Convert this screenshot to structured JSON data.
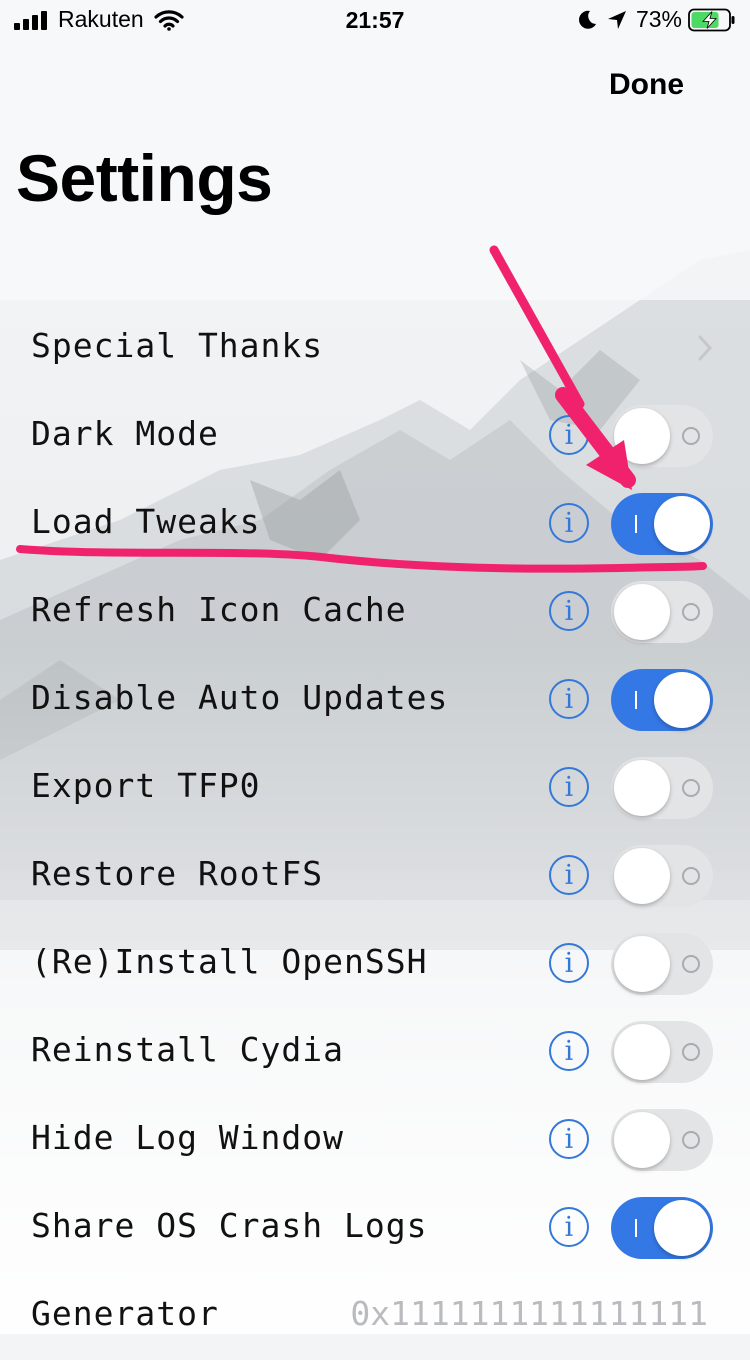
{
  "status_bar": {
    "carrier": "Rakuten",
    "time": "21:57",
    "battery_percent": "73%",
    "battery_level": 0.73,
    "icons": [
      "signal-icon",
      "wifi-icon",
      "moon-icon",
      "location-icon",
      "battery-charging-icon"
    ]
  },
  "nav": {
    "done_label": "Done"
  },
  "page": {
    "title": "Settings"
  },
  "settings": [
    {
      "label": "Special Thanks",
      "type": "link"
    },
    {
      "label": "Dark Mode",
      "type": "toggle",
      "on": false
    },
    {
      "label": "Load Tweaks",
      "type": "toggle",
      "on": true
    },
    {
      "label": "Refresh Icon Cache",
      "type": "toggle",
      "on": false
    },
    {
      "label": "Disable Auto Updates",
      "type": "toggle",
      "on": true
    },
    {
      "label": "Export TFP0",
      "type": "toggle",
      "on": false
    },
    {
      "label": "Restore RootFS",
      "type": "toggle",
      "on": false
    },
    {
      "label": "(Re)Install OpenSSH",
      "type": "toggle",
      "on": false
    },
    {
      "label": "Reinstall Cydia",
      "type": "toggle",
      "on": false
    },
    {
      "label": "Hide Log Window",
      "type": "toggle",
      "on": false
    },
    {
      "label": "Share OS Crash Logs",
      "type": "toggle",
      "on": true
    },
    {
      "label": "Generator",
      "type": "value",
      "value": "0x1111111111111111"
    }
  ],
  "colors": {
    "accent": "#3478e6",
    "info_blue": "#3478d8",
    "annotation": "#f0226e"
  },
  "annotation": {
    "kind": "arrow-and-underline",
    "target": "Load Tweaks"
  }
}
